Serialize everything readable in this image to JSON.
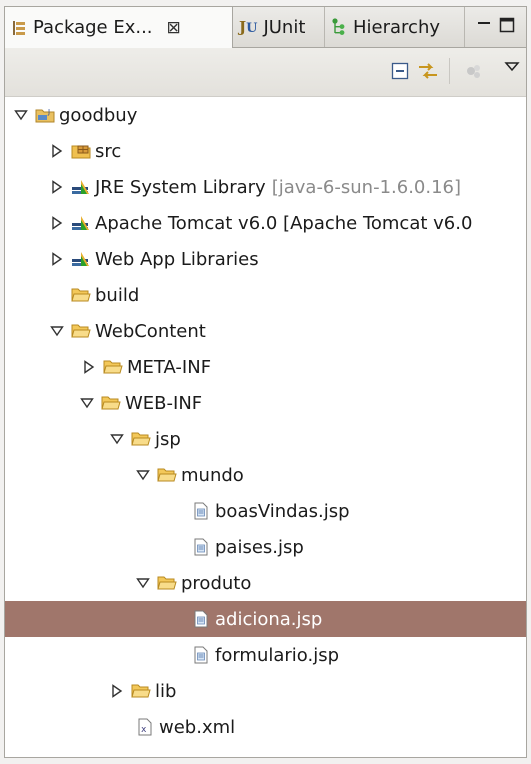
{
  "tabs": [
    {
      "label": "Package Ex...",
      "icon": "package-explorer-icon",
      "active": true,
      "close": "⊠"
    },
    {
      "label": "JUnit",
      "icon": "junit-icon",
      "active": false
    },
    {
      "label": "Hierarchy",
      "icon": "hierarchy-icon",
      "active": false
    }
  ],
  "toolbar": {
    "collapse_icon": "collapse-all-icon",
    "link_icon": "link-with-editor-icon",
    "menu_icon": "view-menu-icon"
  },
  "tree": [
    {
      "id": "goodbuy",
      "label": "goodbuy",
      "icon": "project-icon",
      "twisty": "expanded",
      "depth": 0
    },
    {
      "id": "src",
      "label": "src",
      "icon": "package-folder-icon",
      "twisty": "collapsed",
      "depth": 1
    },
    {
      "id": "jre",
      "label": "JRE System Library",
      "decoration": "[java-6-sun-1.6.0.16]",
      "icon": "library-icon",
      "twisty": "collapsed",
      "depth": 1
    },
    {
      "id": "tomcat",
      "label": "Apache Tomcat v6.0 [Apache Tomcat v6.0",
      "icon": "library-icon",
      "twisty": "collapsed",
      "depth": 1
    },
    {
      "id": "webapplibs",
      "label": "Web App Libraries",
      "icon": "library-icon",
      "twisty": "collapsed",
      "depth": 1
    },
    {
      "id": "build",
      "label": "build",
      "icon": "folder-icon",
      "twisty": "none",
      "depth": 1
    },
    {
      "id": "webcontent",
      "label": "WebContent",
      "icon": "folder-icon",
      "twisty": "expanded",
      "depth": 1
    },
    {
      "id": "metainf",
      "label": "META-INF",
      "icon": "folder-icon",
      "twisty": "collapsed",
      "depth": 2
    },
    {
      "id": "webinf",
      "label": "WEB-INF",
      "icon": "folder-icon",
      "twisty": "expanded",
      "depth": 2
    },
    {
      "id": "jsp",
      "label": "jsp",
      "icon": "folder-icon",
      "twisty": "expanded",
      "depth": 3
    },
    {
      "id": "mundo",
      "label": "mundo",
      "icon": "folder-icon",
      "twisty": "expanded",
      "depth": 4
    },
    {
      "id": "boasvindas",
      "label": "boasVindas.jsp",
      "icon": "jsp-file-icon",
      "twisty": "none",
      "depth": 5
    },
    {
      "id": "paises",
      "label": "paises.jsp",
      "icon": "jsp-file-icon",
      "twisty": "none",
      "depth": 5
    },
    {
      "id": "produto",
      "label": "produto",
      "icon": "folder-icon",
      "twisty": "expanded",
      "depth": 4
    },
    {
      "id": "adiciona",
      "label": "adiciona.jsp",
      "icon": "jsp-file-icon",
      "twisty": "none",
      "depth": 5,
      "selected": true
    },
    {
      "id": "formulario",
      "label": "formulario.jsp",
      "icon": "jsp-file-icon",
      "twisty": "none",
      "depth": 5
    },
    {
      "id": "lib",
      "label": "lib",
      "icon": "folder-icon",
      "twisty": "collapsed",
      "depth": 3
    },
    {
      "id": "webxml",
      "label": "web.xml",
      "icon": "xml-file-icon",
      "twisty": "none",
      "depth": 3
    }
  ],
  "colors": {
    "selection": "#a0766b",
    "folder": "#e8b64a",
    "decoration": "#8a8a8a"
  }
}
